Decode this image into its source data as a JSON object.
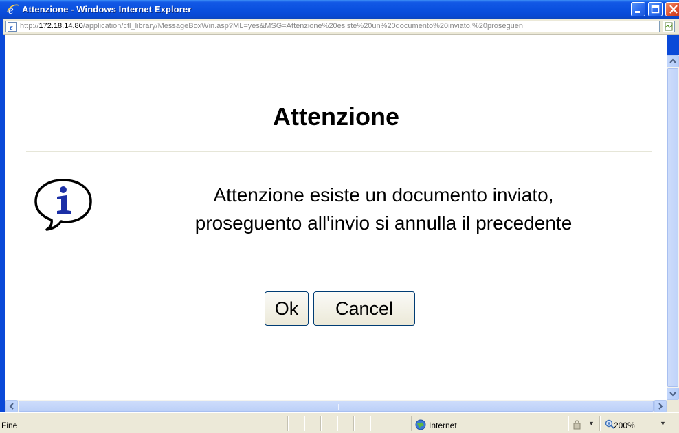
{
  "window": {
    "title": "Attenzione - Windows Internet Explorer"
  },
  "address": {
    "protocol": "http://",
    "host": "172.18.14.80",
    "path": "/application/ctl_library/MessageBoxWin.asp?ML=yes&MSG=Attenzione%20esiste%20un%20documento%20inviato,%20proseguen"
  },
  "dialog": {
    "heading": "Attenzione",
    "message_line1": "Attenzione esiste un documento inviato,",
    "message_line2": "proseguento all'invio si annulla il precedente",
    "ok_label": "Ok",
    "cancel_label": "Cancel"
  },
  "status": {
    "text": "Fine",
    "zone": "Internet",
    "zoom": "200%"
  },
  "colors": {
    "titlebar": "#0a50df",
    "chrome": "#ece9d8",
    "info_icon_blue": "#1b2fa6"
  }
}
